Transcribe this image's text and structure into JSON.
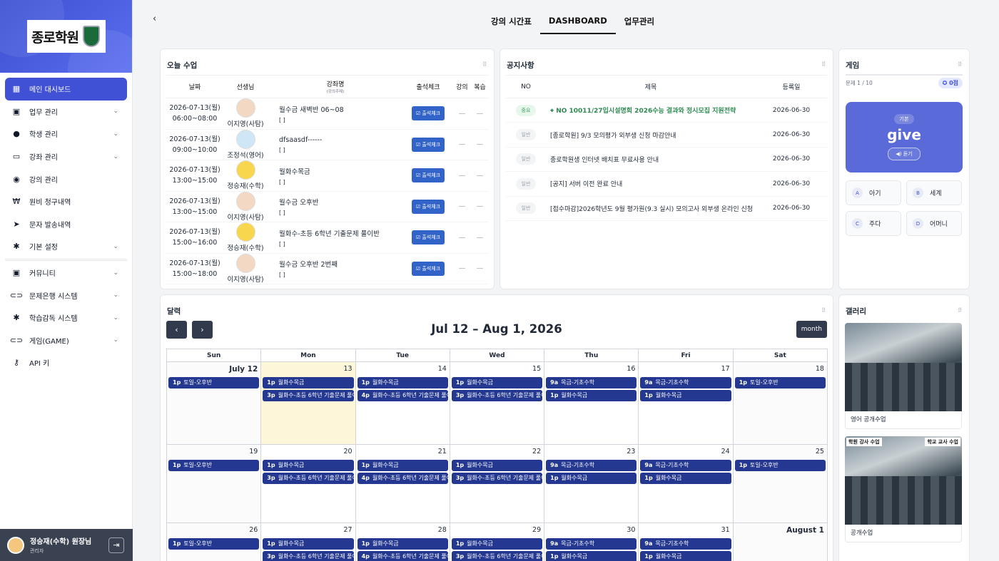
{
  "sidebar": {
    "logo_text": "종로학원",
    "items": [
      {
        "label": "메인 대시보드",
        "icon": "dashboard-icon",
        "active": true
      },
      {
        "label": "업무 관리",
        "icon": "calendar-icon",
        "chev": true
      },
      {
        "label": "학생 관리",
        "icon": "person-icon",
        "chev": true
      },
      {
        "label": "강좌 관리",
        "icon": "laptop-icon",
        "chev": true
      },
      {
        "label": "강의 관리",
        "icon": "play-icon"
      },
      {
        "label": "원비 청구내역",
        "icon": "won-icon"
      },
      {
        "label": "문자 발송내역",
        "icon": "send-icon"
      },
      {
        "label": "기본 설정",
        "icon": "gear-icon",
        "chev": true
      },
      {
        "label": "커뮤니티",
        "icon": "calendar-icon",
        "chev": true
      },
      {
        "label": "문제은행 시스템",
        "icon": "gamepad-icon",
        "chev": true
      },
      {
        "label": "학습감독 시스템",
        "icon": "gear-icon",
        "chev": true
      },
      {
        "label": "게임(GAME)",
        "icon": "gamepad-icon",
        "chev": true
      },
      {
        "label": "API 키",
        "icon": "key-icon"
      }
    ],
    "user": {
      "name": "정승재(수학) 원장님",
      "role": "관리자"
    }
  },
  "topnav": {
    "back": "‹",
    "tabs": [
      "강의 시간표",
      "DASHBOARD",
      "업무관리"
    ],
    "active_tab": 1
  },
  "today": {
    "title": "오늘 수업",
    "headers": {
      "date": "날짜",
      "teacher": "선생님",
      "lecture": "강좌명",
      "lecture_sub": "(강의주제)",
      "check": "출석체크",
      "lec": "강의",
      "review": "복습"
    },
    "rows": [
      {
        "date": "2026-07-13(월)",
        "time": "06:00~08:00",
        "teacher": "이지영(사탐)",
        "face": "",
        "lecture": "월수금 새벽반 06~08",
        "topic": "[ ]"
      },
      {
        "date": "2026-07-13(월)",
        "time": "09:00~10:00",
        "teacher": "조정석(영어)",
        "face": "b",
        "lecture": "dfsaasdf------",
        "topic": "[ ]"
      },
      {
        "date": "2026-07-13(월)",
        "time": "13:00~15:00",
        "teacher": "정승재(수학)",
        "face": "y",
        "lecture": "월화수목금",
        "topic": "[ ]"
      },
      {
        "date": "2026-07-13(월)",
        "time": "13:00~15:00",
        "teacher": "이지영(사탐)",
        "face": "",
        "lecture": "월수금 오후반",
        "topic": "[ ]"
      },
      {
        "date": "2026-07-13(월)",
        "time": "15:00~16:00",
        "teacher": "정승재(수학)",
        "face": "y",
        "lecture": "월화수-초등 6학년 기출문제 풀이반",
        "topic": "[ ]"
      },
      {
        "date": "2026-07-13(월)",
        "time": "15:00~18:00",
        "teacher": "이지영(사탐)",
        "face": "",
        "lecture": "월수금 오후반 2번째",
        "topic": "[ ]"
      }
    ],
    "check_label": "출석체크",
    "dash": "—"
  },
  "notice": {
    "title": "공지사항",
    "headers": {
      "no": "NO",
      "subject": "제목",
      "date": "등록일"
    },
    "rows": [
      {
        "badge": "중요",
        "imp": true,
        "subject": "NO 10011/27입시설명회 2026수능 결과와 정시모집 지원전략",
        "date": "2026-06-30"
      },
      {
        "badge": "일반",
        "imp": false,
        "subject": "[종로학원] 9/3 모의평가 외부생 신청 마감안내",
        "date": "2026-06-30"
      },
      {
        "badge": "일반",
        "imp": false,
        "subject": "종로학원생 인터넷 배치표 무료사용 안내",
        "date": "2026-06-30"
      },
      {
        "badge": "일반",
        "imp": false,
        "subject": "[공지] 서버 이전 완료 안내",
        "date": "2026-06-30"
      },
      {
        "badge": "일반",
        "imp": false,
        "subject": "[접수마감]2026학년도 9월 평가원(9.3 실시) 모의고사 외부생 온라인 신청",
        "date": "2026-06-30"
      }
    ]
  },
  "game": {
    "title": "게임",
    "progress": "문제 1 / 10",
    "score": "0점",
    "level": "기본",
    "word": "give",
    "listen": "듣기",
    "options": [
      {
        "key": "A",
        "text": "아기"
      },
      {
        "key": "B",
        "text": "세계"
      },
      {
        "key": "C",
        "text": "주다"
      },
      {
        "key": "D",
        "text": "어머니"
      }
    ]
  },
  "calendar": {
    "title": "달력",
    "range": "Jul 12 – Aug 1, 2026",
    "view": "month",
    "prev": "‹",
    "next": "›",
    "weekdays": [
      "Sun",
      "Mon",
      "Tue",
      "Wed",
      "Thu",
      "Fri",
      "Sat"
    ],
    "weeks": [
      {
        "days": [
          "July 12",
          "13",
          "14",
          "15",
          "16",
          "17",
          "18"
        ],
        "today": 1
      },
      {
        "days": [
          "19",
          "20",
          "21",
          "22",
          "23",
          "24",
          "25"
        ],
        "today": -1
      },
      {
        "days": [
          "26",
          "27",
          "28",
          "29",
          "30",
          "31",
          "August 1"
        ],
        "today": -1
      }
    ],
    "events": {
      "sun": [
        {
          "t": "1p",
          "n": "토일-오후반"
        }
      ],
      "mon": [
        {
          "t": "1p",
          "n": "월화수목금"
        },
        {
          "t": "3p",
          "n": "월화수-초등 6학년 기출문제 풀이반"
        }
      ],
      "tue": [
        {
          "t": "1p",
          "n": "월화수목금"
        },
        {
          "t": "4p",
          "n": "월화수-초등 6학년 기출문제 풀이반"
        }
      ],
      "wed": [
        {
          "t": "1p",
          "n": "월화수목금"
        },
        {
          "t": "3p",
          "n": "월화수-초등 6학년 기출문제 풀이반"
        }
      ],
      "thu": [
        {
          "t": "9a",
          "n": "목금-기초수학"
        },
        {
          "t": "1p",
          "n": "월화수목금"
        }
      ],
      "fri": [
        {
          "t": "9a",
          "n": "목금-기초수학"
        },
        {
          "t": "1p",
          "n": "월화수목금"
        }
      ],
      "sat": [
        {
          "t": "1p",
          "n": "토일-오후반"
        }
      ]
    }
  },
  "gallery": {
    "title": "갤러리",
    "items": [
      {
        "caption": "영어 공개수업"
      },
      {
        "caption": "공개수업",
        "labels": [
          "학원 강사 수업",
          "학교 교사 수업"
        ]
      }
    ]
  },
  "colors": {
    "accent": "#4051d6",
    "event": "#253891",
    "today_bg": "#fdf6d8"
  }
}
